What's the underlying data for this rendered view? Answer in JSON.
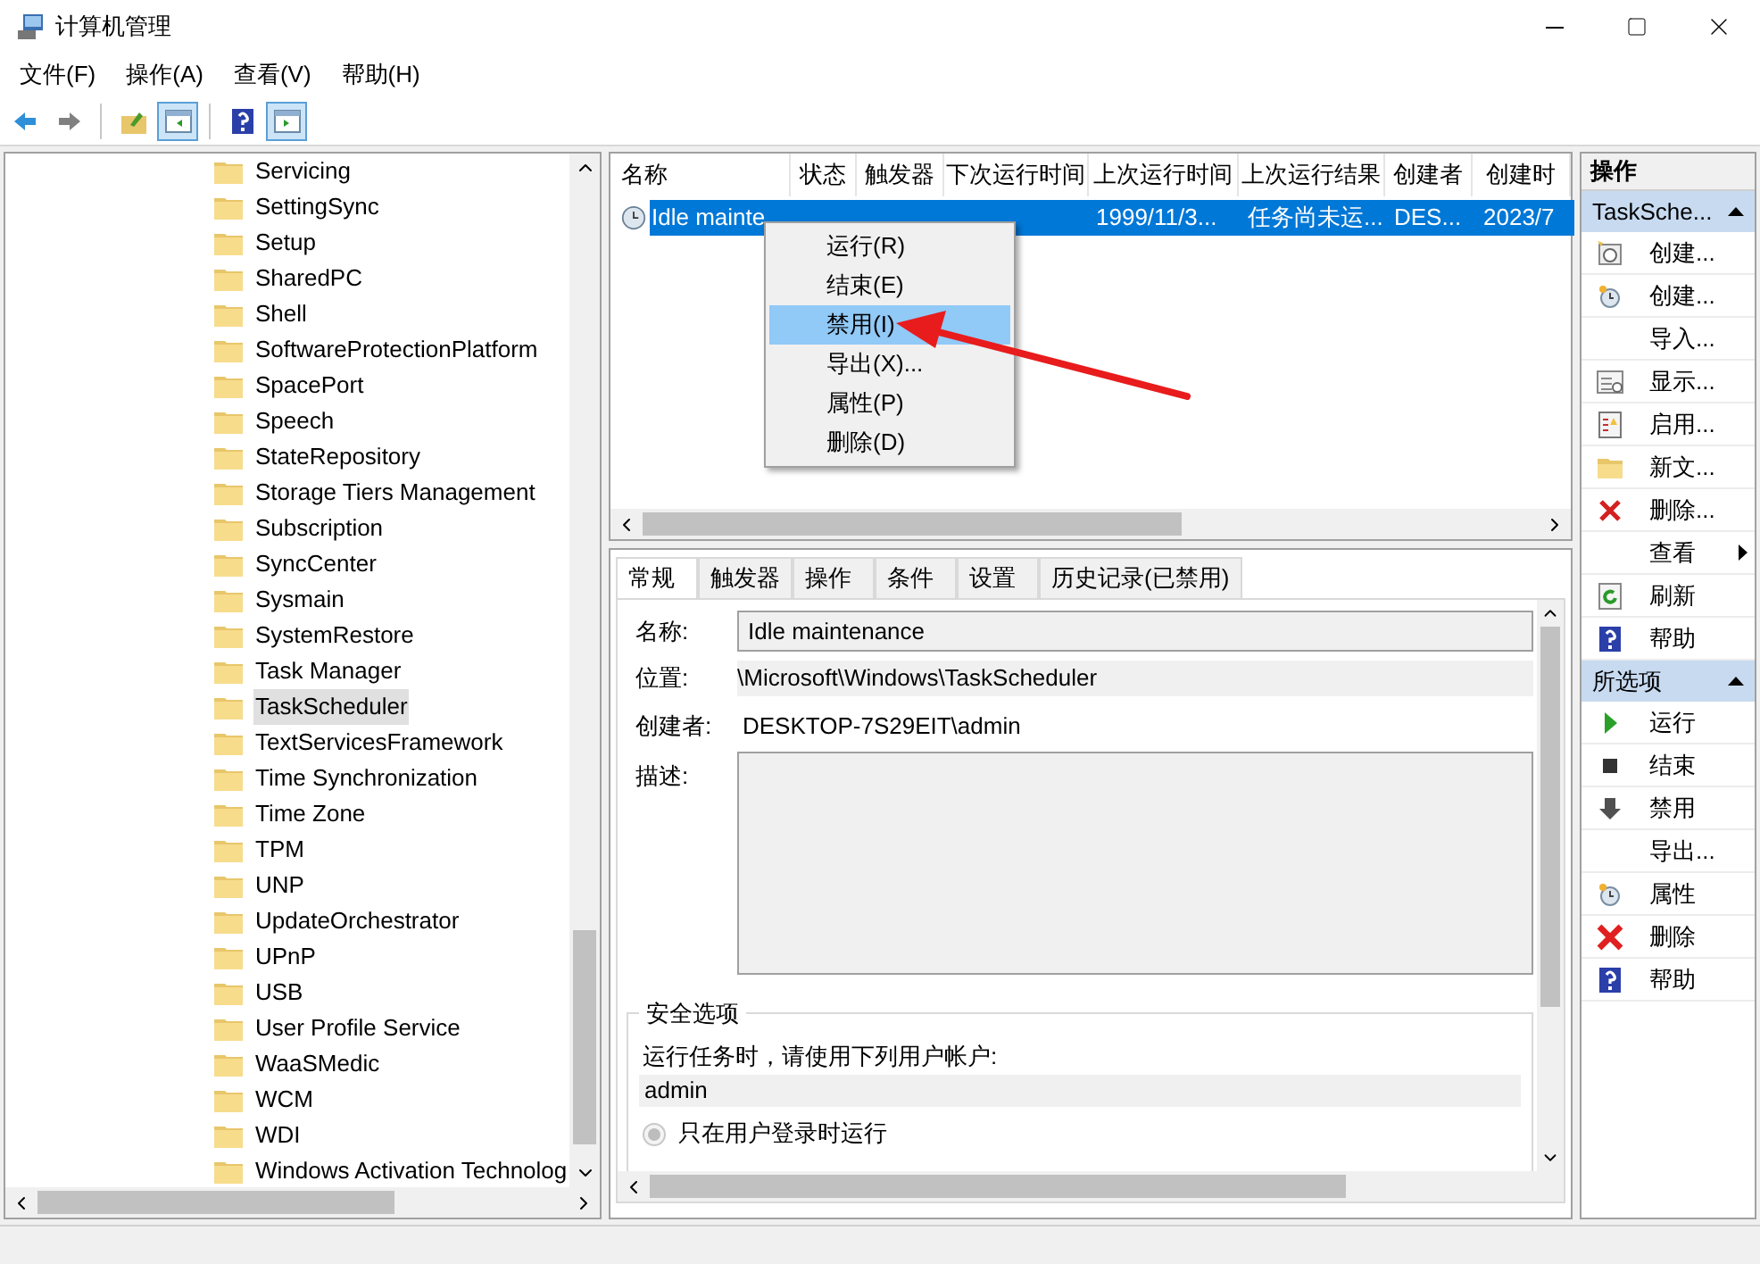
{
  "window": {
    "title": "计算机管理"
  },
  "menu_bar": [
    "文件(F)",
    "操作(A)",
    "查看(V)",
    "帮助(H)"
  ],
  "toolbar": [
    {
      "kind": "back",
      "selected": false
    },
    {
      "kind": "forward",
      "selected": false
    },
    {
      "kind": "separator"
    },
    {
      "kind": "up",
      "selected": false
    },
    {
      "kind": "pane",
      "selected": true
    },
    {
      "kind": "separator"
    },
    {
      "kind": "help",
      "selected": false
    },
    {
      "kind": "pane2",
      "selected": true
    }
  ],
  "tree": {
    "items": [
      {
        "label": "Servicing",
        "selected": false
      },
      {
        "label": "SettingSync",
        "selected": false
      },
      {
        "label": "Setup",
        "selected": false
      },
      {
        "label": "SharedPC",
        "selected": false
      },
      {
        "label": "Shell",
        "selected": false
      },
      {
        "label": "SoftwareProtectionPlatform",
        "selected": false
      },
      {
        "label": "SpacePort",
        "selected": false
      },
      {
        "label": "Speech",
        "selected": false
      },
      {
        "label": "StateRepository",
        "selected": false
      },
      {
        "label": "Storage Tiers Management",
        "selected": false
      },
      {
        "label": "Subscription",
        "selected": false
      },
      {
        "label": "SyncCenter",
        "selected": false
      },
      {
        "label": "Sysmain",
        "selected": false
      },
      {
        "label": "SystemRestore",
        "selected": false
      },
      {
        "label": "Task Manager",
        "selected": false
      },
      {
        "label": "TaskScheduler",
        "selected": true
      },
      {
        "label": "TextServicesFramework",
        "selected": false
      },
      {
        "label": "Time Synchronization",
        "selected": false
      },
      {
        "label": "Time Zone",
        "selected": false
      },
      {
        "label": "TPM",
        "selected": false
      },
      {
        "label": "UNP",
        "selected": false
      },
      {
        "label": "UpdateOrchestrator",
        "selected": false
      },
      {
        "label": "UPnP",
        "selected": false
      },
      {
        "label": "USB",
        "selected": false
      },
      {
        "label": "User Profile Service",
        "selected": false
      },
      {
        "label": "WaaSMedic",
        "selected": false
      },
      {
        "label": "WCM",
        "selected": false
      },
      {
        "label": "WDI",
        "selected": false
      },
      {
        "label": "Windows Activation Technolog",
        "selected": false
      }
    ]
  },
  "task_list": {
    "columns": [
      "名称",
      "状态",
      "触发器",
      "下次运行时间",
      "上次运行时间",
      "上次运行结果",
      "创建者",
      "创建时"
    ],
    "rows": [
      {
        "selected": true,
        "cells": [
          "Idle mainte",
          "",
          "",
          "",
          "1999/11/3...",
          "任务尚未运...",
          "DES...",
          "2023/7"
        ]
      }
    ]
  },
  "context_menu": {
    "items": [
      {
        "label": "运行(R)",
        "selected": false
      },
      {
        "label": "结束(E)",
        "selected": false
      },
      {
        "label": "禁用(I)",
        "selected": true
      },
      {
        "label": "导出(X)...",
        "selected": false
      },
      {
        "label": "属性(P)",
        "selected": false
      },
      {
        "label": "删除(D)",
        "selected": false
      }
    ]
  },
  "detail_tabs": [
    {
      "label": "常规",
      "selected": true
    },
    {
      "label": "触发器",
      "selected": false
    },
    {
      "label": "操作",
      "selected": false
    },
    {
      "label": "条件",
      "selected": false
    },
    {
      "label": "设置",
      "selected": false
    },
    {
      "label": "历史记录(已禁用)",
      "selected": false
    }
  ],
  "general": {
    "name_label": "名称:",
    "name_value": "Idle maintenance",
    "location_label": "位置:",
    "location_value": "\\Microsoft\\Windows\\TaskScheduler",
    "author_label": "创建者:",
    "author_value": "DESKTOP-7S29EIT\\admin",
    "description_label": "描述:",
    "security": {
      "title": "安全选项",
      "prompt": "运行任务时，请使用下列用户帐户:",
      "account": "admin",
      "options": [
        {
          "label": "只在用户登录时运行",
          "selected": true
        }
      ]
    }
  },
  "actions": {
    "title": "操作",
    "sections": [
      {
        "title": "TaskSche...",
        "items": [
          {
            "label": "创建...",
            "kind": "new-task"
          },
          {
            "label": "创建...",
            "kind": "clock"
          },
          {
            "label": "导入...",
            "kind": "plain"
          },
          {
            "label": "显示...",
            "kind": "list"
          },
          {
            "label": "启用...",
            "kind": "log"
          },
          {
            "label": "新文...",
            "kind": "folder"
          },
          {
            "label": "删除...",
            "kind": "delete"
          },
          {
            "label": "查看",
            "kind": "plain",
            "submenu": true
          },
          {
            "label": "刷新",
            "kind": "refresh"
          },
          {
            "label": "帮助",
            "kind": "help"
          }
        ]
      },
      {
        "title": "所选项",
        "items": [
          {
            "label": "运行",
            "kind": "run"
          },
          {
            "label": "结束",
            "kind": "stop"
          },
          {
            "label": "禁用",
            "kind": "disable"
          },
          {
            "label": "导出...",
            "kind": "plain"
          },
          {
            "label": "属性",
            "kind": "clock"
          },
          {
            "label": "删除",
            "kind": "delete-large"
          },
          {
            "label": "帮助",
            "kind": "help"
          }
        ]
      }
    ]
  }
}
